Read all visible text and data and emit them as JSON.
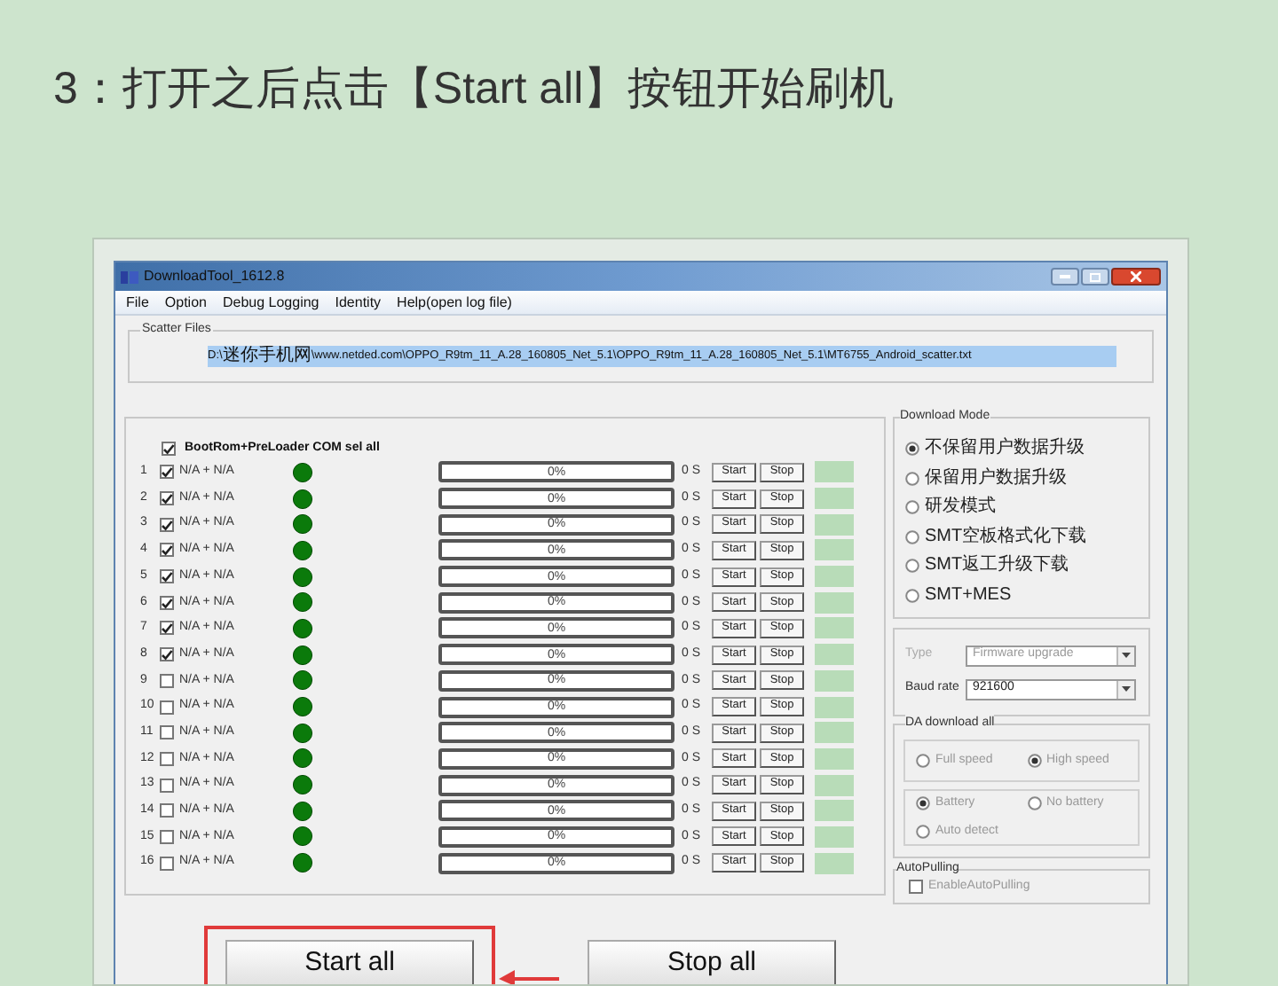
{
  "article": {
    "heading": "3：打开之后点击【Start all】按钮开始刷机"
  },
  "window": {
    "title": "DownloadTool_1612.8",
    "menu": [
      {
        "label": "File"
      },
      {
        "label": "Option"
      },
      {
        "label": "Debug Logging"
      },
      {
        "label": "Identity"
      },
      {
        "label": "Help(open log file)"
      }
    ]
  },
  "scatter_files": {
    "label": "Scatter Files",
    "value": "D:\\迷你手机网\\www.netded.com\\OPPO_R9tm_11_A.28_160805_Net_5.1\\OPPO_R9tm_11_A.28_160805_Net_5.1\\MT6755_Android_scatter.txt"
  },
  "ports": {
    "sel_all": {
      "label": "BootRom+PreLoader COM sel all",
      "checked": true
    },
    "rows": [
      {
        "number": "1",
        "checked": true,
        "device": "N/A + N/A",
        "level": 0,
        "progress": "0%",
        "time": "0 S",
        "start": "Start",
        "stop": "Stop"
      },
      {
        "number": "2",
        "checked": true,
        "device": "N/A + N/A",
        "level": 0,
        "progress": "0%",
        "time": "0 S",
        "start": "Start",
        "stop": "Stop"
      },
      {
        "number": "3",
        "checked": true,
        "device": "N/A + N/A",
        "level": 0,
        "progress": "0%",
        "time": "0 S",
        "start": "Start",
        "stop": "Stop"
      },
      {
        "number": "4",
        "checked": true,
        "device": "N/A + N/A",
        "level": 0,
        "progress": "0%",
        "time": "0 S",
        "start": "Start",
        "stop": "Stop"
      },
      {
        "number": "5",
        "checked": true,
        "device": "N/A + N/A",
        "level": 0,
        "progress": "0%",
        "time": "0 S",
        "start": "Start",
        "stop": "Stop"
      },
      {
        "number": "6",
        "checked": true,
        "device": "N/A + N/A",
        "level": 0,
        "progress": "0%",
        "time": "0 S",
        "start": "Start",
        "stop": "Stop"
      },
      {
        "number": "7",
        "checked": true,
        "device": "N/A + N/A",
        "level": 0,
        "progress": "0%",
        "time": "0 S",
        "start": "Start",
        "stop": "Stop"
      },
      {
        "number": "8",
        "checked": true,
        "device": "N/A + N/A",
        "level": 0,
        "progress": "0%",
        "time": "0 S",
        "start": "Start",
        "stop": "Stop"
      },
      {
        "number": "9",
        "checked": false,
        "device": "N/A + N/A",
        "level": 0,
        "progress": "0%",
        "time": "0 S",
        "start": "Start",
        "stop": "Stop"
      },
      {
        "number": "10",
        "checked": false,
        "device": "N/A + N/A",
        "level": 0,
        "progress": "0%",
        "time": "0 S",
        "start": "Start",
        "stop": "Stop"
      },
      {
        "number": "11",
        "checked": false,
        "device": "N/A + N/A",
        "level": 0,
        "progress": "0%",
        "time": "0 S",
        "start": "Start",
        "stop": "Stop"
      },
      {
        "number": "12",
        "checked": false,
        "device": "N/A + N/A",
        "level": 0,
        "progress": "0%",
        "time": "0 S",
        "start": "Start",
        "stop": "Stop"
      },
      {
        "number": "13",
        "checked": false,
        "device": "N/A + N/A",
        "level": 0,
        "progress": "0%",
        "time": "0 S",
        "start": "Start",
        "stop": "Stop"
      },
      {
        "number": "14",
        "checked": false,
        "device": "N/A + N/A",
        "level": 0,
        "progress": "0%",
        "time": "0 S",
        "start": "Start",
        "stop": "Stop"
      },
      {
        "number": "15",
        "checked": false,
        "device": "N/A + N/A",
        "level": 0,
        "progress": "0%",
        "time": "0 S",
        "start": "Start",
        "stop": "Stop"
      },
      {
        "number": "16",
        "checked": false,
        "device": "N/A + N/A",
        "level": 0,
        "progress": "0%",
        "time": "0 S",
        "start": "Start",
        "stop": "Stop"
      }
    ]
  },
  "download_mode": {
    "title": "Download Mode",
    "options": [
      {
        "label": "不保留用户数据升级",
        "selected": true
      },
      {
        "label": "保留用户数据升级",
        "selected": false
      },
      {
        "label": "研发模式",
        "selected": false
      },
      {
        "label": "SMT空板格式化下载",
        "selected": false
      },
      {
        "label": "SMT返工升级下载",
        "selected": false
      },
      {
        "label": "SMT+MES",
        "selected": false
      }
    ]
  },
  "settings": {
    "type": {
      "label": "Type",
      "value": "Firmware upgrade",
      "disabled": true
    },
    "baud_rate": {
      "label": "Baud rate",
      "value": "921600",
      "disabled": false
    }
  },
  "da_download": {
    "title": "DA download all",
    "speed": [
      {
        "label": "Full speed",
        "selected": false
      },
      {
        "label": "High speed",
        "selected": true
      }
    ],
    "power": [
      {
        "label": "Battery",
        "selected": true
      },
      {
        "label": "No battery",
        "selected": false
      },
      {
        "label": "Auto detect",
        "selected": false
      }
    ]
  },
  "auto_pulling": {
    "title": "AutoPulling",
    "option": {
      "label": "EnableAutoPulling",
      "checked": false
    }
  },
  "actions": [
    {
      "label": "Start all",
      "highlighted": true
    },
    {
      "label": "Stop all",
      "highlighted": false
    }
  ]
}
